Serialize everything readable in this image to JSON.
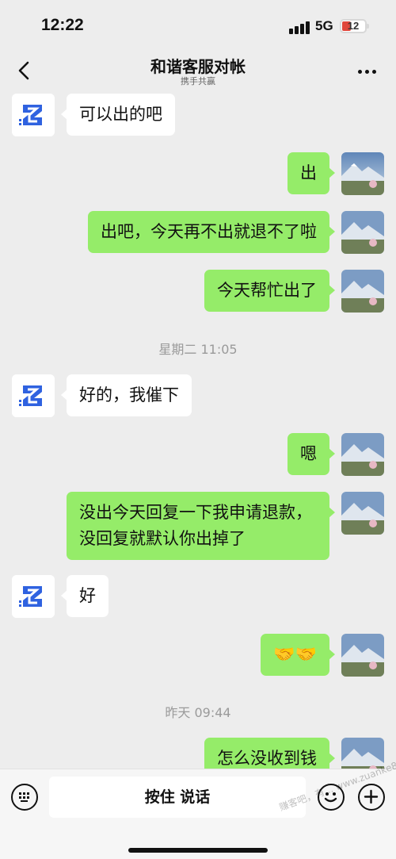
{
  "status": {
    "time": "12:22",
    "network": "5G",
    "battery": "12"
  },
  "header": {
    "title": "和谐客服对帐",
    "subtitle": "携手共赢"
  },
  "messages": [
    {
      "side": "left",
      "text": "可以出的吧"
    },
    {
      "side": "right",
      "text": "出"
    },
    {
      "side": "right",
      "text": "出吧，今天再不出就退不了啦"
    },
    {
      "side": "right",
      "text": "今天帮忙出了"
    },
    {
      "type": "time",
      "text": "星期二 11:05"
    },
    {
      "side": "left",
      "text": "好的，我催下"
    },
    {
      "side": "right",
      "text": "嗯"
    },
    {
      "side": "right",
      "text": "没出今天回复一下我申请退款，没回复就默认你出掉了"
    },
    {
      "side": "left",
      "text": "好"
    },
    {
      "side": "right",
      "text": "🤝🤝"
    },
    {
      "type": "time",
      "text": "昨天 09:44"
    },
    {
      "side": "right",
      "text": "怎么没收到钱"
    }
  ],
  "input": {
    "hold_to_talk": "按住 说话"
  },
  "watermark": "赚客吧，有... www.zuanke8.com",
  "colors": {
    "sent_bubble": "#95ec69",
    "received_bubble": "#ffffff",
    "background": "#ededed"
  }
}
